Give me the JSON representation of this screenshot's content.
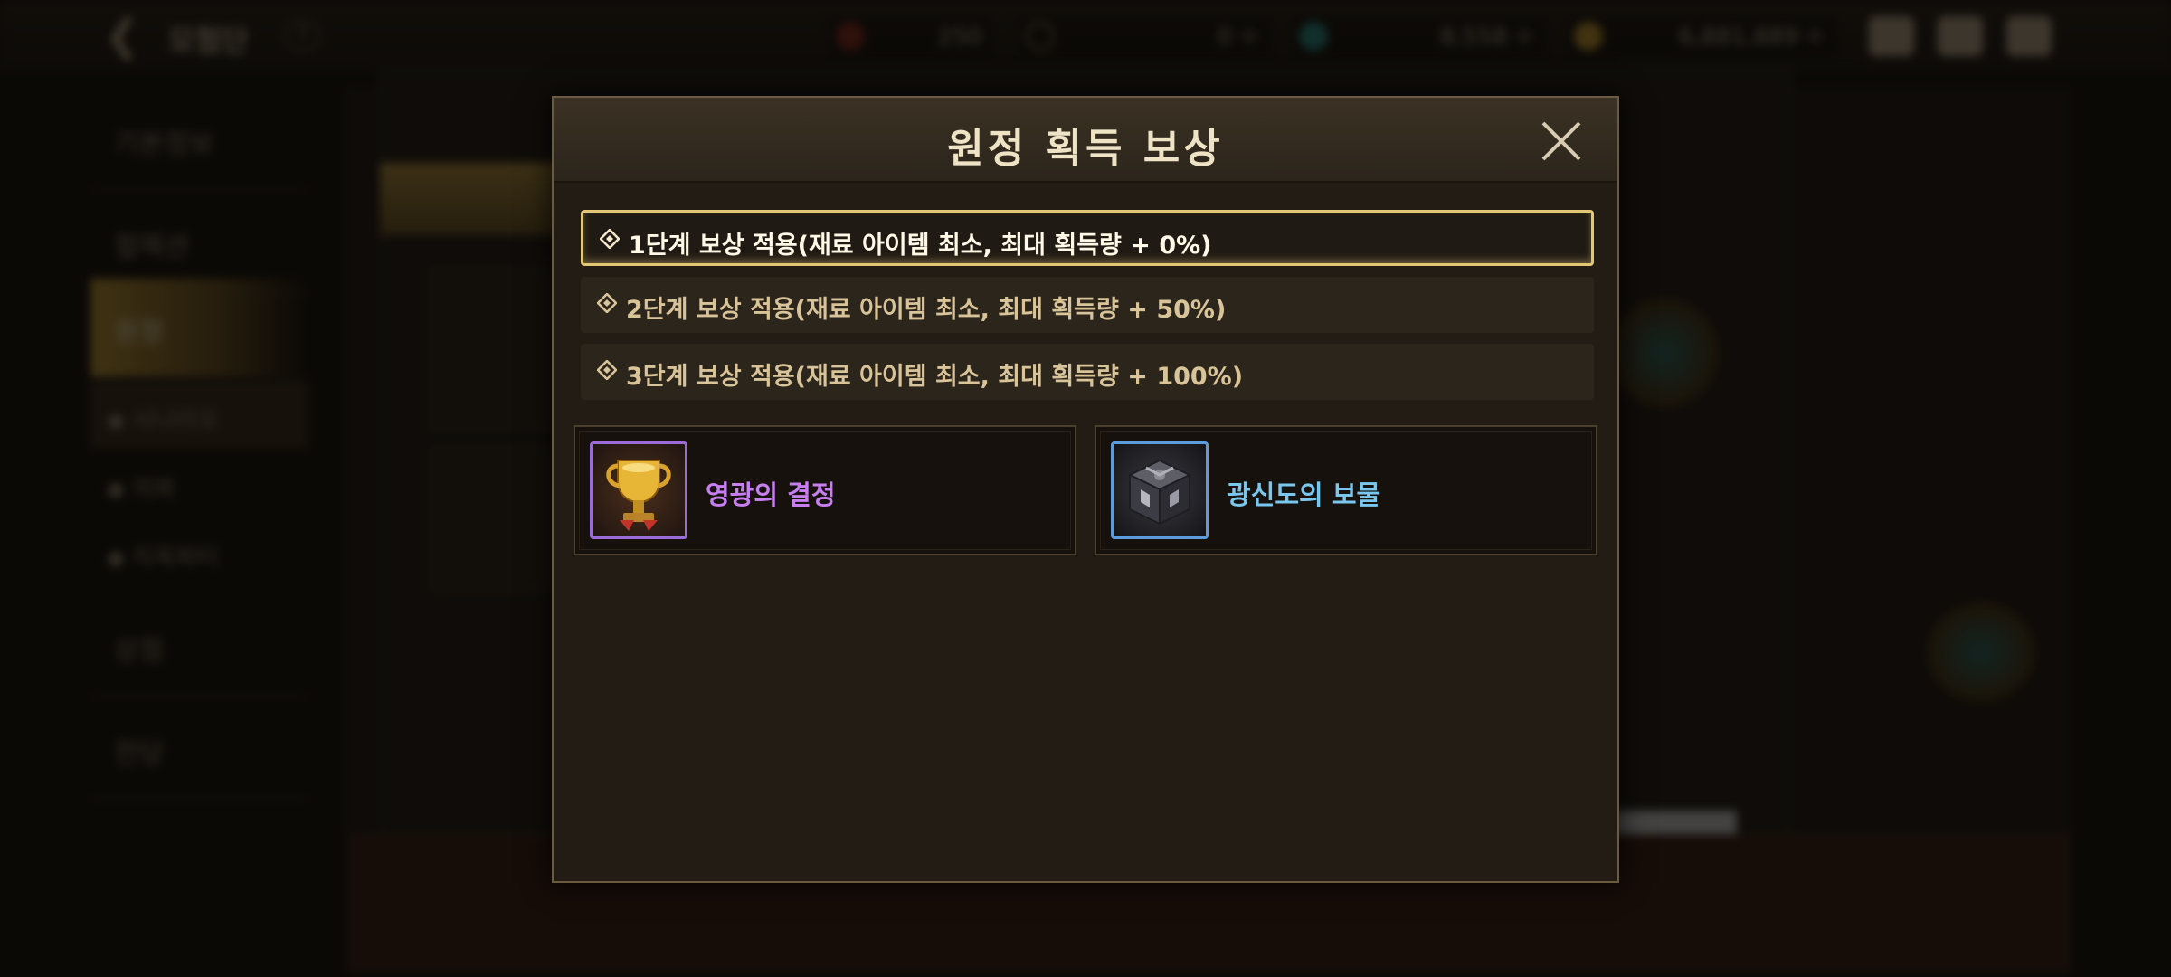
{
  "topbar": {
    "title": "모험단",
    "help_label": "?",
    "resources": [
      {
        "icon": "trophy-icon",
        "value": "250",
        "has_plus": false
      },
      {
        "icon": "coin-c-icon",
        "value": "0",
        "has_plus": true
      },
      {
        "icon": "gem-icon",
        "value": "8,558",
        "has_plus": true
      },
      {
        "icon": "gold-coin-icon",
        "value": "6,881,889",
        "has_plus": true
      }
    ],
    "plus_label": "+"
  },
  "sidebar": {
    "items": [
      {
        "label": "기본정보"
      },
      {
        "label": "컬렉션"
      },
      {
        "label": "원정"
      },
      {
        "label": "상점"
      },
      {
        "label": "전당"
      }
    ],
    "sub_items": [
      {
        "label": "◆ 시나리오"
      },
      {
        "label": "◆ 의뢰"
      },
      {
        "label": "◆ 지옥파티"
      }
    ]
  },
  "modal": {
    "title": "원정 획득 보상",
    "tiers": [
      {
        "label": "1단계 보상 적용(재료 아이템 최소, 최대 획득량 + 0%)",
        "selected": true
      },
      {
        "label": "2단계 보상 적용(재료 아이템 최소, 최대 획득량 + 50%)",
        "selected": false
      },
      {
        "label": "3단계 보상 적용(재료 아이템 최소, 최대 획득량 + 100%)",
        "selected": false
      }
    ],
    "rewards": [
      {
        "name": "영광의 결정",
        "icon": "golden-trophy-icon",
        "rarity_color": "#c77ff0"
      },
      {
        "name": "광신도의 보물",
        "icon": "dark-treasure-box-icon",
        "rarity_color": "#79c6ee"
      }
    ]
  },
  "colors": {
    "accent_gold": "#e3c774",
    "epic_purple": "#c77ff0",
    "rare_blue": "#79c6ee"
  }
}
